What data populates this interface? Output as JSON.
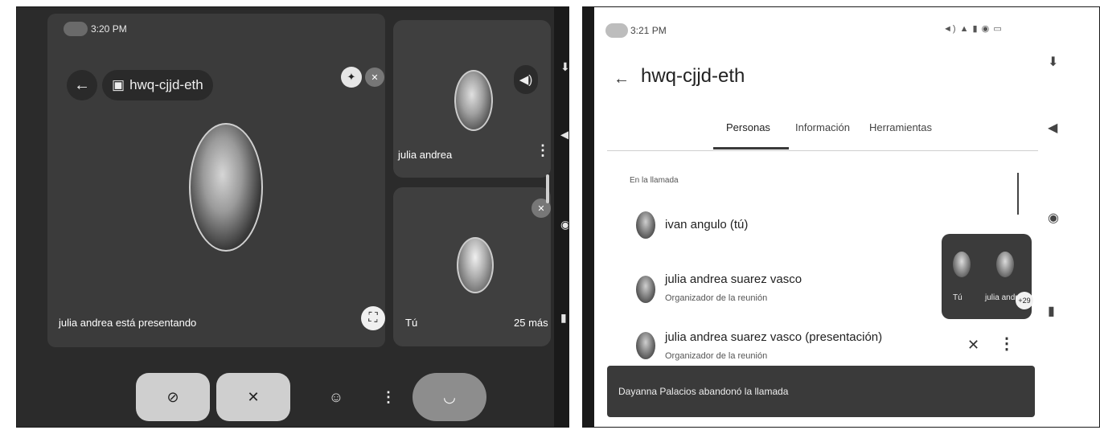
{
  "left": {
    "status_time": "3:20 PM",
    "meeting_code": "hwq-cjjd-eth",
    "presenting_text": "julia andrea está presentando",
    "tile1_name": "julia andrea",
    "tile2_name": "Tú",
    "more_count": "25 más",
    "icons": {
      "back": "←",
      "calendar": "▣",
      "pin": "✦",
      "mic_off": "✕",
      "speaker": "◀)",
      "fullscreen": "⛶",
      "cam_off": "⊘",
      "mic": "✕",
      "emoji": "☺",
      "more": "⋮",
      "hangup": "◡"
    }
  },
  "right": {
    "status_time": "3:21 PM",
    "title": "hwq-cjjd-eth",
    "tabs": [
      "Personas",
      "Información",
      "Herramientas"
    ],
    "section_label": "En la llamada",
    "participants": [
      {
        "name": "ivan angulo (tú)",
        "role": ""
      },
      {
        "name": "julia andrea suarez vasco",
        "role": "Organizador de la reunión"
      },
      {
        "name": "julia andrea suarez vasco (presentación)",
        "role": "Organizador de la reunión"
      }
    ],
    "mini_labels": [
      "Tú",
      "julia andr"
    ],
    "mini_count": "+29",
    "toast": "Dayanna Palacios abandonó la llamada"
  }
}
